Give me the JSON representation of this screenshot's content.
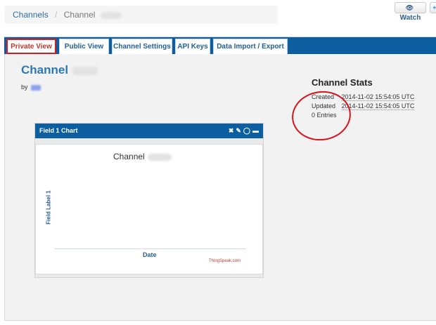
{
  "breadcrumb": {
    "root": "Channels",
    "separator": "/",
    "current": "Channel"
  },
  "header_buttons": {
    "watch_label": "Watch"
  },
  "tabs": [
    {
      "label": "Private View",
      "active": true
    },
    {
      "label": "Public View",
      "active": false
    },
    {
      "label": "Channel Settings",
      "active": false
    },
    {
      "label": "API Keys",
      "active": false
    },
    {
      "label": "Data Import / Export",
      "active": false
    }
  ],
  "channel": {
    "title": "Channel",
    "by_label": "by"
  },
  "stats": {
    "title": "Channel Stats",
    "created_label": "Created",
    "created_value": "2014-11-02 15:54:05 UTC",
    "updated_label": "Updated",
    "updated_value": "2014-11-02 15:54:05 UTC",
    "entries": "0 Entries"
  },
  "widget": {
    "title": "Field 1 Chart",
    "icons": [
      "close-icon",
      "pencil-icon",
      "comment-icon",
      "minimize-icon"
    ]
  },
  "chart_data": {
    "type": "line",
    "title": "Channel",
    "xlabel": "Date",
    "ylabel": "Field Label 1",
    "series": [],
    "credit": "ThingSpeak.com"
  },
  "colors": {
    "tab_bar": "#0b5fa0",
    "active_tab_border": "#d11e1e",
    "annotation_circle": "#d8141a",
    "link": "#2a78b5"
  }
}
